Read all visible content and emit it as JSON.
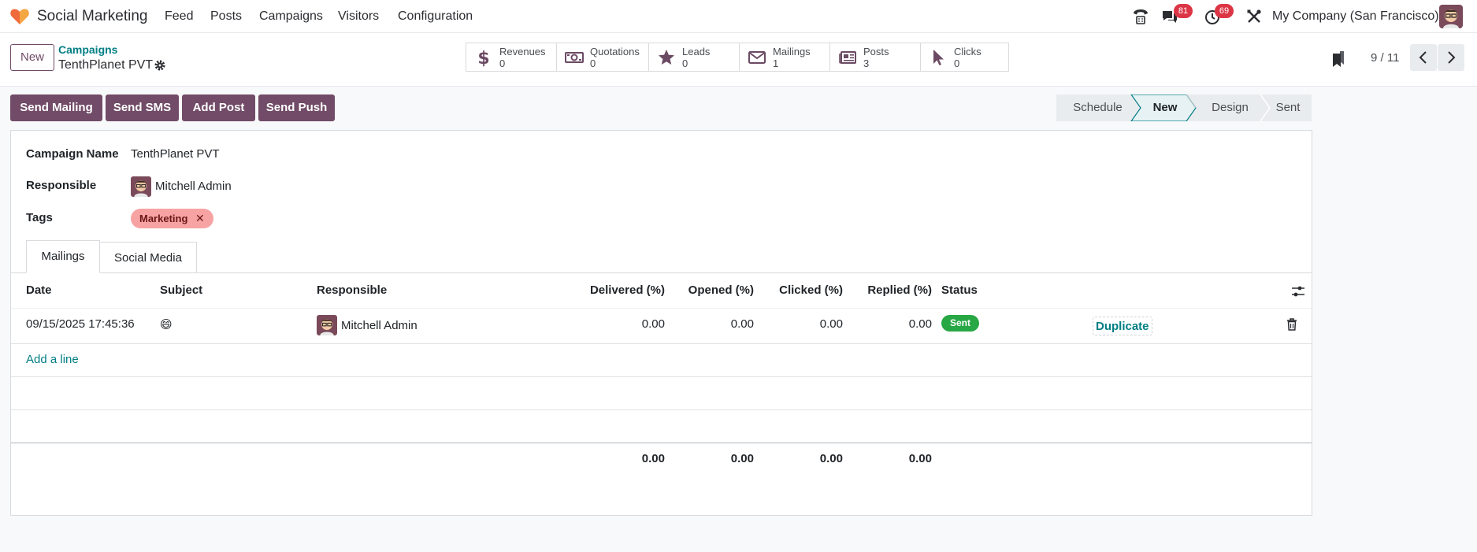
{
  "navbar": {
    "app_name": "Social Marketing",
    "menus": [
      "Feed",
      "Posts",
      "Campaigns",
      "Visitors",
      "Configuration"
    ],
    "messages_badge": "81",
    "activities_badge": "69",
    "company": "My Company (San Francisco)"
  },
  "control": {
    "new_label": "New",
    "breadcrumb_parent": "Campaigns",
    "breadcrumb_current": "TenthPlanet PVT",
    "stats": [
      {
        "label": "Revenues",
        "value": "0",
        "icon": "dollar-icon"
      },
      {
        "label": "Quotations",
        "value": "0",
        "icon": "money-icon"
      },
      {
        "label": "Leads",
        "value": "0",
        "icon": "star-icon"
      },
      {
        "label": "Mailings",
        "value": "1",
        "icon": "envelope-icon"
      },
      {
        "label": "Posts",
        "value": "3",
        "icon": "newspaper-icon"
      },
      {
        "label": "Clicks",
        "value": "0",
        "icon": "cursor-icon"
      }
    ],
    "pager": "9 / 11"
  },
  "actions": {
    "send_mailing": "Send Mailing",
    "send_sms": "Send SMS",
    "add_post": "Add Post",
    "send_push": "Send Push"
  },
  "stages": {
    "items": [
      "Schedule",
      "New",
      "Design",
      "Sent"
    ],
    "active": "New"
  },
  "form": {
    "campaign_name_label": "Campaign Name",
    "campaign_name": "TenthPlanet PVT",
    "responsible_label": "Responsible",
    "responsible": "Mitchell Admin",
    "tags_label": "Tags",
    "tags": [
      "Marketing"
    ],
    "tag_color": "#f7a3a3"
  },
  "tabs": {
    "mailings": "Mailings",
    "social_media": "Social Media"
  },
  "table": {
    "headers": {
      "date": "Date",
      "subject": "Subject",
      "responsible": "Responsible",
      "delivered": "Delivered (%)",
      "opened": "Opened (%)",
      "clicked": "Clicked (%)",
      "replied": "Replied (%)",
      "status": "Status"
    },
    "rows": [
      {
        "date": "09/15/2025 17:45:36",
        "subject": "😄",
        "responsible": "Mitchell Admin",
        "delivered": "0.00",
        "opened": "0.00",
        "clicked": "0.00",
        "replied": "0.00",
        "status": "Sent",
        "action": "Duplicate"
      }
    ],
    "add_line": "Add a line",
    "totals": {
      "delivered": "0.00",
      "opened": "0.00",
      "clicked": "0.00",
      "replied": "0.00"
    }
  },
  "colors": {
    "brand": "#714b67",
    "link": "#017e84",
    "success": "#28a745",
    "badge": "#dc3545"
  }
}
